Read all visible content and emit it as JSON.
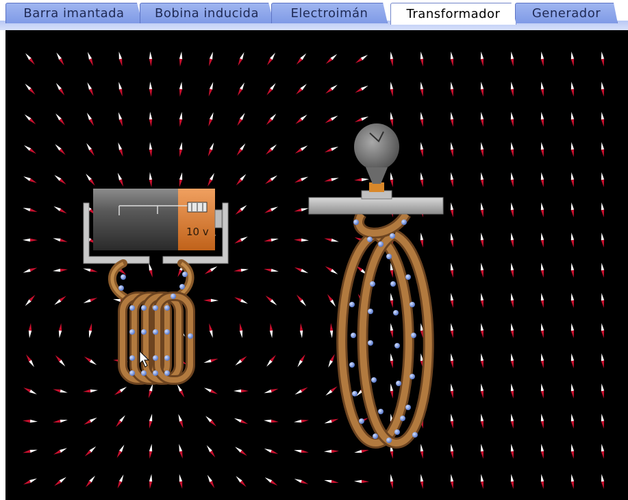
{
  "tabs": [
    {
      "label": "Barra imantada",
      "selected": false
    },
    {
      "label": "Bobina inducida",
      "selected": false
    },
    {
      "label": "Electroimán",
      "selected": false
    },
    {
      "label": "Transformador",
      "selected": true
    },
    {
      "label": "Generador",
      "selected": false
    }
  ],
  "battery": {
    "voltage_label": "10 v"
  },
  "colors": {
    "canvas_background": "#000000",
    "tab_active": "#ffffff",
    "tab_inactive": "#8fa6ec",
    "wire": "#b27a3f",
    "electron": "#7f9fe6",
    "battery_accent": "#d97a2b",
    "compass_north": "#c8102e",
    "compass_south": "#ffffff"
  }
}
